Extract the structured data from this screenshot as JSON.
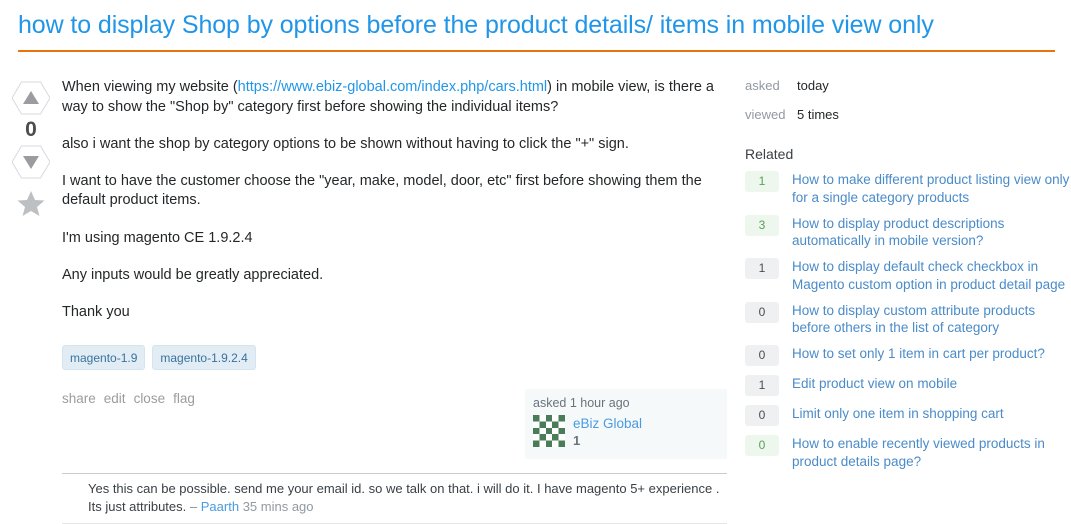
{
  "question": {
    "title": "how to display Shop by options before the product details/ items in mobile view only",
    "vote_count": "0",
    "body_paragraphs": [
      {
        "before": "When viewing my website (",
        "link": "https://www.ebiz-global.com/index.php/cars.html",
        "after": ") in mobile view, is there a way to show the \"Shop by\" category first before showing the individual items?"
      },
      {
        "before": "also i want the shop by category options to be shown without having to click the \"+\" sign.",
        "link": "",
        "after": ""
      },
      {
        "before": "I want to have the customer choose the \"year, make, model, door, etc\" first before showing them the default product items.",
        "link": "",
        "after": ""
      },
      {
        "before": "I'm using magento CE 1.9.2.4",
        "link": "",
        "after": ""
      },
      {
        "before": "Any inputs would be greatly appreciated.",
        "link": "",
        "after": ""
      },
      {
        "before": "Thank you",
        "link": "",
        "after": ""
      }
    ],
    "tags": [
      "magento-1.9",
      "magento-1.9.2.4"
    ],
    "menu": [
      "share",
      "edit",
      "close",
      "flag"
    ],
    "owner": {
      "action_time": "asked 1 hour ago",
      "name": "eBiz Global",
      "reputation": "1"
    }
  },
  "comments": [
    {
      "text": "Yes this can be possible. send me your email id. so we talk on that. i will do it. I have magento 5+ experience . Its just attributes.",
      "dash": "–",
      "user": "Paarth",
      "date": "35 mins ago"
    }
  ],
  "sidebar": {
    "stats": [
      {
        "key": "asked",
        "value": "today"
      },
      {
        "key": "viewed",
        "value": "5 times"
      }
    ],
    "related_heading": "Related",
    "related": [
      {
        "votes": "1",
        "answered": true,
        "title": "How to make different product listing view only for a single category products"
      },
      {
        "votes": "3",
        "answered": true,
        "title": "How to display product descriptions automatically in mobile version?"
      },
      {
        "votes": "1",
        "answered": false,
        "title": "How to display default check checkbox in Magento custom option in product detail page"
      },
      {
        "votes": "0",
        "answered": false,
        "title": "How to display custom attribute products before others in the list of category"
      },
      {
        "votes": "0",
        "answered": false,
        "title": "How to set only 1 item in cart per product?"
      },
      {
        "votes": "1",
        "answered": false,
        "title": "Edit product view on mobile"
      },
      {
        "votes": "0",
        "answered": false,
        "title": "Limit only one item in shopping cart"
      },
      {
        "votes": "0",
        "answered": true,
        "title": "How to enable recently viewed products in product details page?"
      }
    ]
  },
  "colors": {
    "title_link": "#2196e8",
    "rule_orange": "#e8740c",
    "tag_bg": "#e1ecf4",
    "tag_text": "#39739d",
    "answered_badge_bg": "#edf7ed",
    "answered_badge_text": "#5c9e5c",
    "plain_badge_bg": "#eff0f1",
    "sidebar_link": "#4a8bc9",
    "user_card_bg": "#f6f9fa"
  }
}
